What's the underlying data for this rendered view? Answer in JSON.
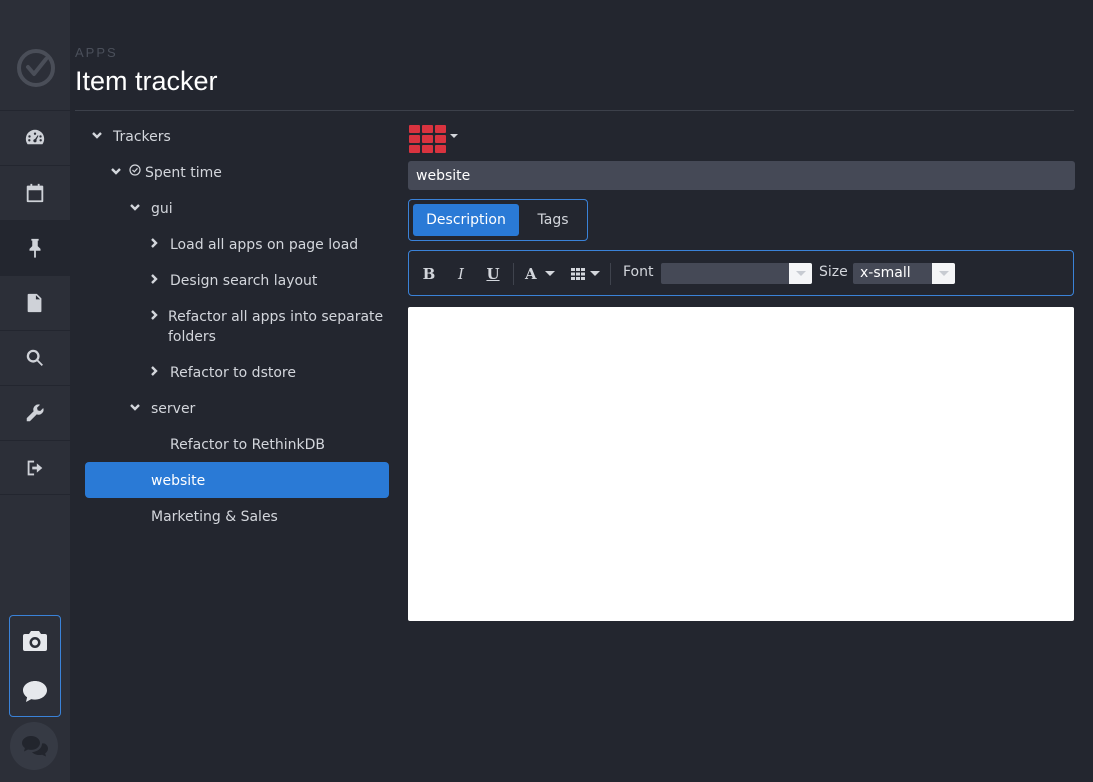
{
  "header": {
    "eyebrow": "APPS",
    "title": "Item tracker"
  },
  "sidebar": {
    "items": [
      {
        "icon": "dashboard-icon"
      },
      {
        "icon": "calendar-icon"
      },
      {
        "icon": "pin-icon"
      },
      {
        "icon": "file-icon"
      },
      {
        "icon": "search-icon"
      },
      {
        "icon": "wrench-icon"
      },
      {
        "icon": "logout-icon"
      }
    ],
    "utilities": [
      "camera-icon",
      "comment-icon",
      "chat-icon"
    ]
  },
  "tree": {
    "trackers": "Trackers",
    "spent_time": "Spent time",
    "gui": "gui",
    "load_all_apps": "Load all apps on page load",
    "design_search": "Design search layout",
    "refactor_apps_line1": "Refactor all apps into separate",
    "refactor_apps_line2": "folders",
    "refactor_dstore": "Refactor to dstore",
    "server": "server",
    "refactor_rethink": "Refactor to RethinkDB",
    "website": "website",
    "marketing": "Marketing & Sales"
  },
  "editor": {
    "title_value": "website",
    "tabs": {
      "description": "Description",
      "tags": "Tags"
    },
    "toolbar": {
      "bold": "B",
      "italic": "I",
      "underline": "U",
      "color_letter": "A",
      "font_label": "Font",
      "font_value": "",
      "size_label": "Size",
      "size_value": "x-small"
    }
  },
  "colors": {
    "accent": "#2a7ad6",
    "grid_icon": "#d9333f",
    "background": "#23262f",
    "sidebar": "#2c2f38"
  }
}
